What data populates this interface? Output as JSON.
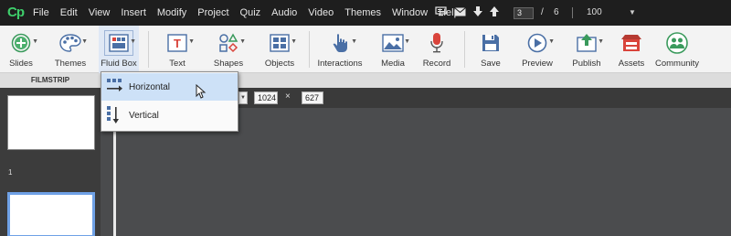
{
  "app": {
    "logo": "Cp"
  },
  "menubar": {
    "items": [
      "File",
      "Edit",
      "View",
      "Insert",
      "Modify",
      "Project",
      "Quiz",
      "Audio",
      "Video",
      "Themes",
      "Window",
      "Help"
    ],
    "icons": [
      "monitor-icon",
      "mail-icon",
      "arrow-down-icon",
      "arrow-up-icon"
    ],
    "current_page": "3",
    "page_separator": "/",
    "total_pages": "6",
    "zoom": "100",
    "zoom_caret": "▼"
  },
  "toolbar": {
    "buttons": [
      {
        "label": "Slides",
        "icon": "add-circle-icon"
      },
      {
        "label": "Themes",
        "icon": "palette-icon"
      },
      {
        "label": "Fluid Box",
        "icon": "fluid-box-icon"
      },
      {
        "label": "Text",
        "icon": "text-icon"
      },
      {
        "label": "Shapes",
        "icon": "shapes-icon"
      },
      {
        "label": "Objects",
        "icon": "objects-icon"
      },
      {
        "label": "Interactions",
        "icon": "hand-pointer-icon"
      },
      {
        "label": "Media",
        "icon": "image-icon"
      },
      {
        "label": "Record",
        "icon": "microphone-icon"
      },
      {
        "label": "Save",
        "icon": "floppy-icon"
      },
      {
        "label": "Preview",
        "icon": "play-icon"
      },
      {
        "label": "Publish",
        "icon": "publish-icon"
      },
      {
        "label": "Assets",
        "icon": "assets-icon"
      },
      {
        "label": "Community",
        "icon": "community-icon"
      }
    ]
  },
  "filmstrip": {
    "header": "FILMSTRIP",
    "slide_numbers": [
      "1"
    ]
  },
  "properties": {
    "width": "1024",
    "height": "627",
    "separator": "×"
  },
  "fluid_box_menu": {
    "items": [
      {
        "label": "Horizontal",
        "icon": "horizontal-layout-icon"
      },
      {
        "label": "Vertical",
        "icon": "vertical-layout-icon"
      }
    ]
  },
  "colors": {
    "menubar_bg": "#1e1e1e",
    "toolbar_bg": "#f3f3f3",
    "logo": "#3ecf6b",
    "menu_hover": "#cde1f7",
    "selected_slide_border": "#6fa1e6",
    "stage_bg": "#4b4c4e"
  }
}
